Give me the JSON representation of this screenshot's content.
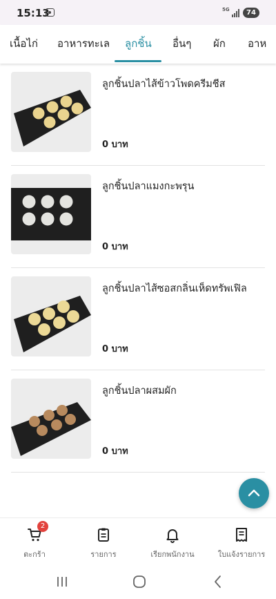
{
  "status_bar": {
    "time": "15:13",
    "network": "5G",
    "battery": "74"
  },
  "tabs": [
    {
      "label": "เนื้อไก่",
      "active": false
    },
    {
      "label": "อาหารทะเล",
      "active": false
    },
    {
      "label": "ลูกชิ้น",
      "active": true
    },
    {
      "label": "อื่นๆ",
      "active": false
    },
    {
      "label": "ผัก",
      "active": false
    },
    {
      "label": "อาห",
      "active": false
    }
  ],
  "products": [
    {
      "name": "ลูกชิ้นปลาไส้ข้าวโพดครีมชีส",
      "price": "0 บาท",
      "image": "cheese-corn-fishballs-on-tray"
    },
    {
      "name": "ลูกชิ้นปลาแมงกะพรุน",
      "price": "0 บาท",
      "image": "white-fishballs-on-tray"
    },
    {
      "name": "ลูกชิ้นปลาไส้ซอสกลิ่นเห็ดทรัพเฟิล",
      "price": "0 บาท",
      "image": "truffle-fishballs-on-tray"
    },
    {
      "name": "ลูกชิ้นปลาผสมผัก",
      "price": "0 บาท",
      "image": "vegetable-fishballs-on-tray"
    }
  ],
  "bottom_nav": [
    {
      "label": "ตะกร้า",
      "icon": "cart-icon",
      "badge": "2"
    },
    {
      "label": "รายการ",
      "icon": "clipboard-icon"
    },
    {
      "label": "เรียกพนักงาน",
      "icon": "bell-icon"
    },
    {
      "label": "ใบแจ้งรายการ",
      "icon": "receipt-icon"
    }
  ],
  "colors": {
    "accent": "#2a8fa3",
    "badge": "#e2423d"
  }
}
